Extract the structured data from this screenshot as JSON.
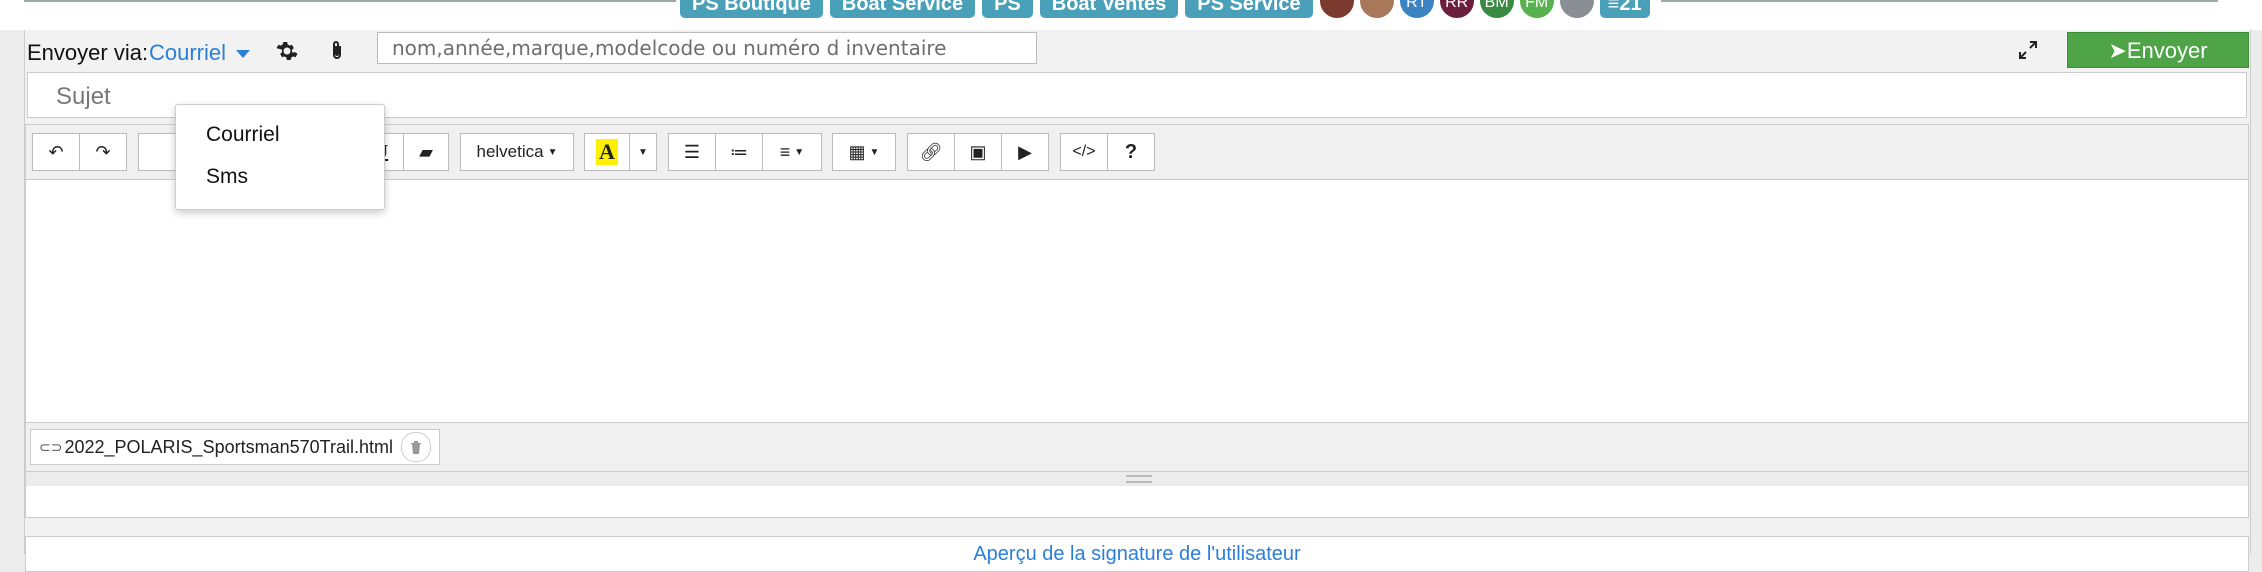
{
  "top_tags": [
    "PS Boutique",
    "Boat Service",
    "PS",
    "Boat Ventes",
    "PS Service"
  ],
  "avatars": [
    {
      "initials": "",
      "color": "#7a3b2e"
    },
    {
      "initials": "",
      "color": "#a9785b"
    },
    {
      "initials": "RT",
      "color": "#3c83c4"
    },
    {
      "initials": "RR",
      "color": "#6b1f3c"
    },
    {
      "initials": "BM",
      "color": "#3a8a42"
    },
    {
      "initials": "FM",
      "color": "#58b04e"
    },
    {
      "initials": "",
      "color": "#8a8f96"
    }
  ],
  "chat_count": "21",
  "send_bar": {
    "label": "Envoyer via:",
    "channel": "Courriel",
    "search_placeholder": "nom,année,marque,modelcode ou numéro d inventaire",
    "send_label": "Envoyer"
  },
  "dropdown": {
    "items": [
      "Courriel",
      "Sms"
    ]
  },
  "subject": {
    "placeholder": "Sujet"
  },
  "toolbar": {
    "font_name": "helvetica",
    "help": "?",
    "code": "</>"
  },
  "attachment": {
    "filename": "2022_POLARIS_Sportsman570Trail.html"
  },
  "signature_link": "Aperçu de la signature de l'utilisateur",
  "colors": {
    "accent_blue": "#2a7fd8",
    "send_green": "#4ea446",
    "tag_teal": "#4aa0b8"
  }
}
